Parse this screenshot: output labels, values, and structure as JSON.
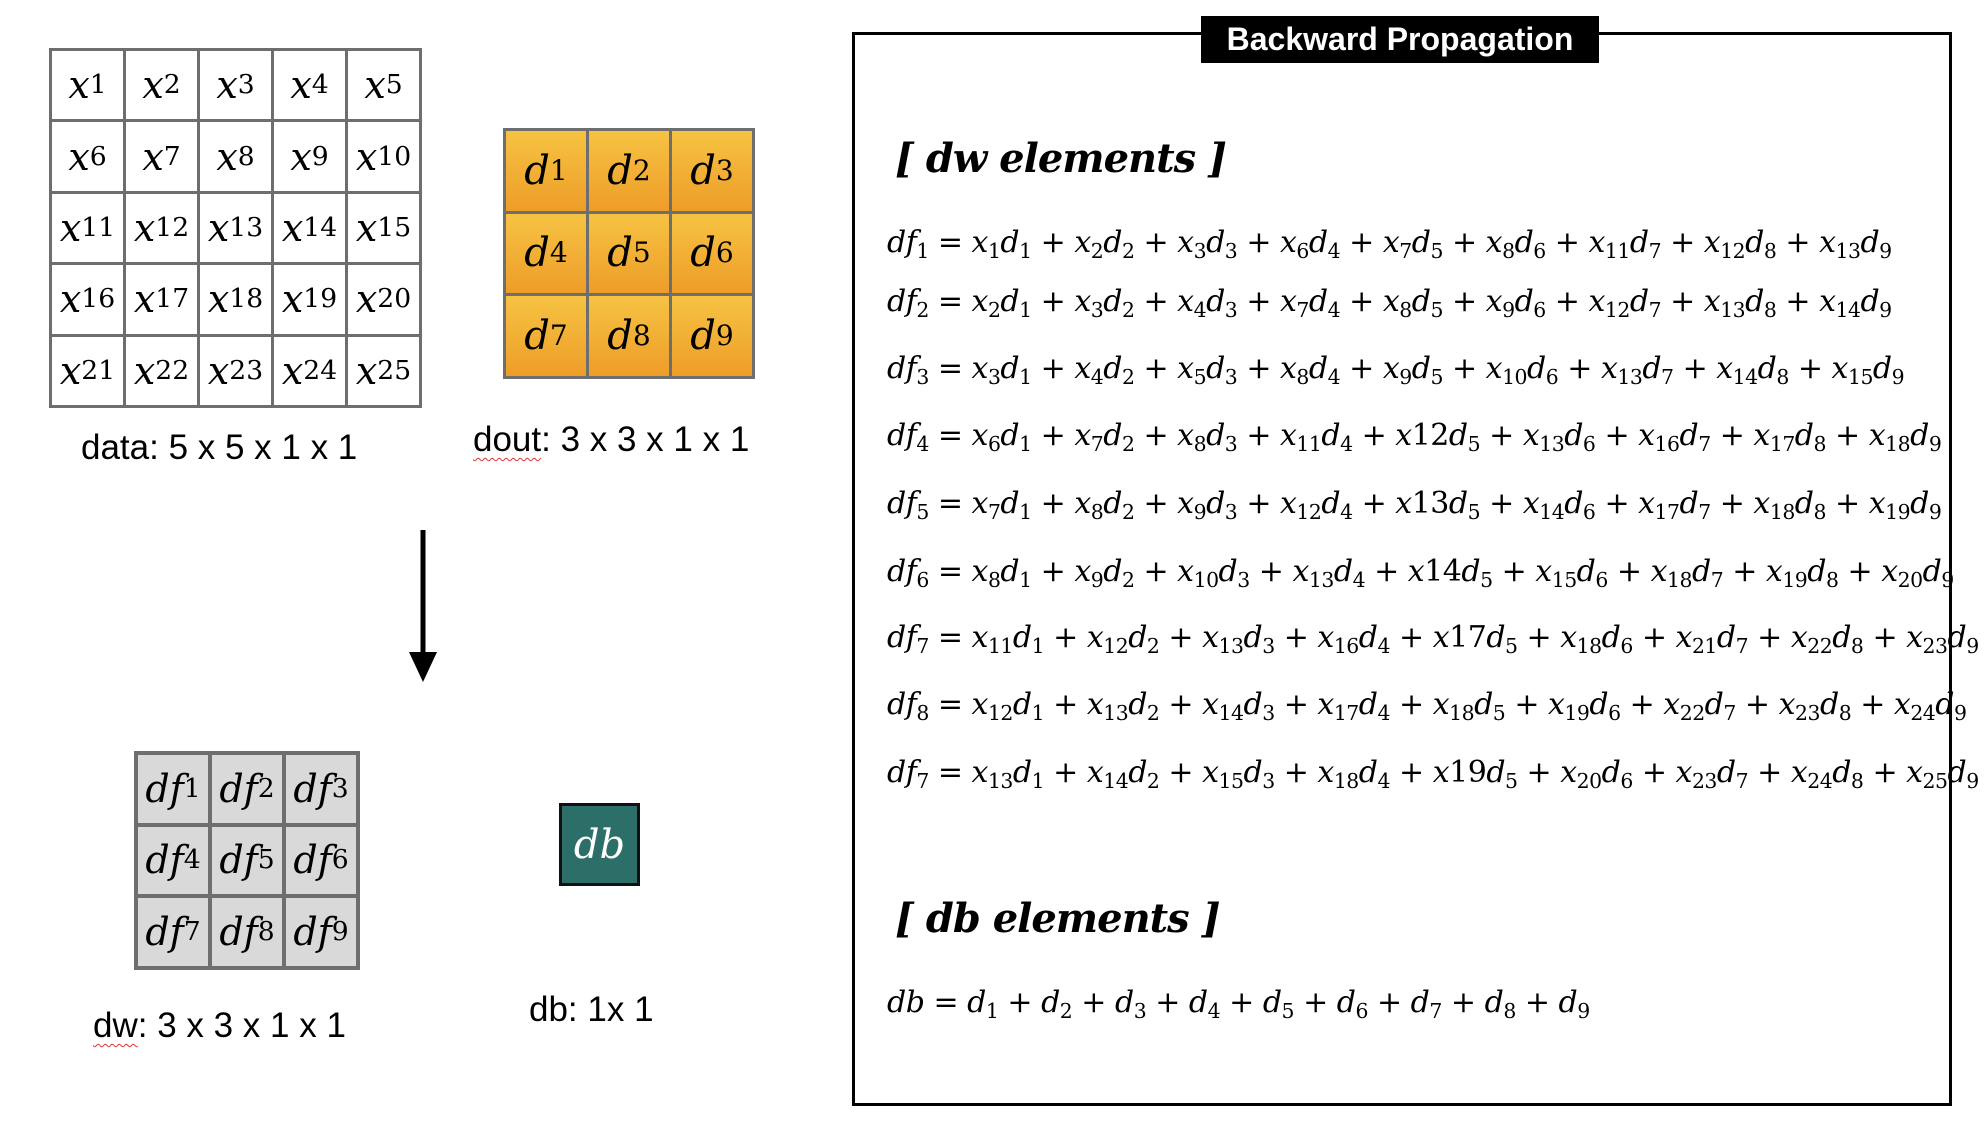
{
  "data_matrix": {
    "label": "data: 5 x 5 x 1 x 1",
    "cells": [
      {
        "b": "x",
        "s": "1"
      },
      {
        "b": "x",
        "s": "2"
      },
      {
        "b": "x",
        "s": "3"
      },
      {
        "b": "x",
        "s": "4"
      },
      {
        "b": "x",
        "s": "5"
      },
      {
        "b": "x",
        "s": "6"
      },
      {
        "b": "x",
        "s": "7"
      },
      {
        "b": "x",
        "s": "8"
      },
      {
        "b": "x",
        "s": "9"
      },
      {
        "b": "x",
        "s": "10"
      },
      {
        "b": "x",
        "s": "11"
      },
      {
        "b": "x",
        "s": "12"
      },
      {
        "b": "x",
        "s": "13"
      },
      {
        "b": "x",
        "s": "14"
      },
      {
        "b": "x",
        "s": "15"
      },
      {
        "b": "x",
        "s": "16"
      },
      {
        "b": "x",
        "s": "17"
      },
      {
        "b": "x",
        "s": "18"
      },
      {
        "b": "x",
        "s": "19"
      },
      {
        "b": "x",
        "s": "20"
      },
      {
        "b": "x",
        "s": "21"
      },
      {
        "b": "x",
        "s": "22"
      },
      {
        "b": "x",
        "s": "23"
      },
      {
        "b": "x",
        "s": "24"
      },
      {
        "b": "x",
        "s": "25"
      }
    ]
  },
  "dout_matrix": {
    "label_prefix": "dout",
    "label_rest": ": 3 x 3 x 1 x 1",
    "cells": [
      {
        "b": "d",
        "s": "1"
      },
      {
        "b": "d",
        "s": "2"
      },
      {
        "b": "d",
        "s": "3"
      },
      {
        "b": "d",
        "s": "4"
      },
      {
        "b": "d",
        "s": "5"
      },
      {
        "b": "d",
        "s": "6"
      },
      {
        "b": "d",
        "s": "7"
      },
      {
        "b": "d",
        "s": "8"
      },
      {
        "b": "d",
        "s": "9"
      }
    ]
  },
  "dw_matrix": {
    "label_prefix": "dw",
    "label_rest": ": 3 x 3 x 1 x 1",
    "cells": [
      {
        "b": "df",
        "s": "1"
      },
      {
        "b": "df",
        "s": "2"
      },
      {
        "b": "df",
        "s": "3"
      },
      {
        "b": "df",
        "s": "4"
      },
      {
        "b": "df",
        "s": "5"
      },
      {
        "b": "df",
        "s": "6"
      },
      {
        "b": "df",
        "s": "7"
      },
      {
        "b": "df",
        "s": "8"
      },
      {
        "b": "df",
        "s": "9"
      }
    ]
  },
  "db_box": {
    "text": "db",
    "label": "db: 1x 1"
  },
  "panel": {
    "title": "Backward Propagation",
    "dw_heading": "[ dw elements ]",
    "db_heading": "[ db elements ]",
    "dw_equations": [
      "df_{1} = x_{1}d_{1} + x_{2}d_{2} + x_{3}d_{3} + x_{6}d_{4} + x_{7}d_{5} + x_{8}d_{6} + x_{11}d_{7} + x_{12}d_{8} + x_{13}d_{9}",
      "df_{2} = x_{2}d_{1} + x_{3}d_{2} + x_{4}d_{3} + x_{7}d_{4} + x_{8}d_{5} + x_{9}d_{6} + x_{12}d_{7} + x_{13}d_{8} + x_{14}d_{9}",
      "df_{3} = x_{3}d_{1} + x_{4}d_{2} + x_{5}d_{3} + x_{8}d_{4} + x_{9}d_{5} + x_{10}d_{6} + x_{13}d_{7} + x_{14}d_{8} + x_{15}d_{9}",
      "df_{4} = x_{6}d_{1} + x_{7}d_{2} + x_{8}d_{3} + x_{11}d_{4} + x12d_{5} + x_{13}d_{6} + x_{16}d_{7} + x_{17}d_{8} + x_{18}d_{9}",
      "df_{5} = x_{7}d_{1} + x_{8}d_{2} + x_{9}d_{3} + x_{12}d_{4} + x13d_{5} + x_{14}d_{6} + x_{17}d_{7} + x_{18}d_{8} + x_{19}d_{9}",
      "df_{6} = x_{8}d_{1} + x_{9}d_{2} + x_{10}d_{3} + x_{13}d_{4} + x14d_{5} + x_{15}d_{6} + x_{18}d_{7} + x_{19}d_{8} + x_{20}d_{9}",
      "df_{7} = x_{11}d_{1} + x_{12}d_{2} + x_{13}d_{3} + x_{16}d_{4} + x17d_{5} + x_{18}d_{6} + x_{21}d_{7} + x_{22}d_{8} + x_{23}d_{9}",
      "df_{8} = x_{12}d_{1} + x_{13}d_{2} + x_{14}d_{3} + x_{17}d_{4} + x_{18}d_{5} + x_{19}d_{6} + x_{22}d_{7} + x_{23}d_{8} + x_{24}d_{9}",
      "df_{7} = x_{13}d_{1} + x_{14}d_{2} + x_{15}d_{3} + x_{18}d_{4} + x19d_{5} + x_{20}d_{6} + x_{23}d_{7} + x_{24}d_{8} + x_{25}d_{9}"
    ],
    "db_equation": "db = d_{1} + d_{2} + d_{3} + d_{4} + d_{5} + d_{6} + d_{7} + d_{8} + d_{9}"
  }
}
